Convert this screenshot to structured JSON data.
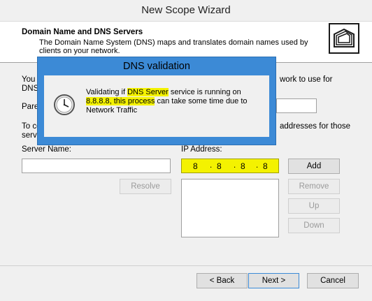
{
  "window": {
    "title": "New Scope Wizard"
  },
  "header": {
    "title": "Domain Name and DNS Servers",
    "description": "The Domain Name System (DNS) maps and translates domain names used by clients on your network."
  },
  "body": {
    "text1_left": "You c",
    "text1_left2": "DNS",
    "text1_right": "work to use for",
    "parent_label": "Pare",
    "text2_left": "To co",
    "text2_left2": "serve",
    "text2_right": "addresses for those",
    "server_name_label": "Server Name:",
    "ip_address_label": "IP Address:",
    "server_name_value": "",
    "ip_octets": [
      "8",
      "8",
      "8",
      "8"
    ],
    "ip_list": []
  },
  "buttons": {
    "resolve": "Resolve",
    "add": "Add",
    "remove": "Remove",
    "up": "Up",
    "down": "Down",
    "back": "< Back",
    "next": "Next >",
    "cancel": "Cancel"
  },
  "dialog": {
    "title": "DNS validation",
    "message_pre": "Validating if ",
    "message_hl1": "DNS Server",
    "message_mid": " service is running on ",
    "message_hl2": "8.8.8.8, this process",
    "message_post": " can take some time due to Network Traffic",
    "icon": "clock-icon"
  },
  "colors": {
    "highlight": "#f4f200",
    "dialog_frame": "#3c8ad6"
  }
}
